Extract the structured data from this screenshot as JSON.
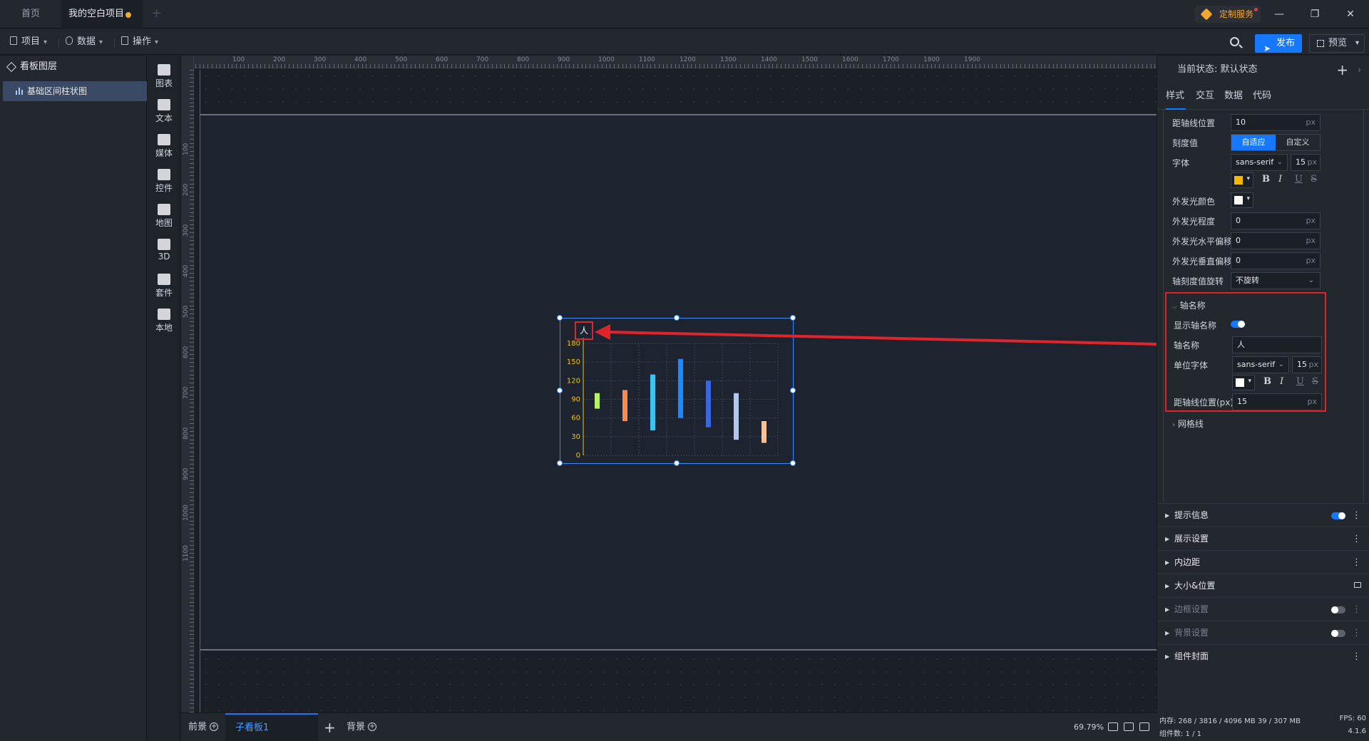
{
  "titlebar": {
    "tabs": [
      "首页",
      "我的空白项目"
    ],
    "custom_service": "定制服务"
  },
  "toolbar": {
    "menus": [
      "项目",
      "数据",
      "操作"
    ],
    "publish": "发布",
    "preview": "预览"
  },
  "layers": {
    "title": "看板图层",
    "items": [
      "基础区间柱状图"
    ]
  },
  "tools": [
    "图表",
    "文本",
    "媒体",
    "控件",
    "地图",
    "3D",
    "套件",
    "本地"
  ],
  "ruler": {
    "top": [
      "100",
      "200",
      "300",
      "400",
      "500",
      "600",
      "700",
      "800",
      "900",
      "1000",
      "1100",
      "1200",
      "1300",
      "1400",
      "1500",
      "1600",
      "1700",
      "1800",
      "1900"
    ],
    "left": [
      "100",
      "200",
      "300",
      "400",
      "500",
      "600",
      "700",
      "800",
      "900",
      "1000",
      "1100"
    ]
  },
  "chart_data": {
    "type": "bar",
    "subtype": "range-bar",
    "y_axis_name": "人",
    "yticks": [
      0,
      30,
      60,
      90,
      120,
      150,
      180
    ],
    "ylim": [
      0,
      180
    ],
    "grid": true,
    "axis_color": "#f0c020",
    "series": [
      {
        "range": [
          75,
          100
        ],
        "color": "#b8f06a"
      },
      {
        "range": [
          55,
          105
        ],
        "color": "#ff8a4c"
      },
      {
        "range": [
          40,
          130
        ],
        "color": "#3fc0f0"
      },
      {
        "range": [
          60,
          155
        ],
        "color": "#1e88ff"
      },
      {
        "range": [
          45,
          120
        ],
        "color": "#3a66e0"
      },
      {
        "range": [
          25,
          100
        ],
        "color": "#b0c8f0"
      },
      {
        "range": [
          20,
          55
        ],
        "color": "#f5c39a"
      }
    ]
  },
  "bottombar": {
    "front": "前景",
    "sub": "子看板1",
    "back": "背景",
    "zoom": "69.79%"
  },
  "props": {
    "state": "当前状态:  默认状态",
    "tabs": [
      "样式",
      "交互",
      "数据",
      "代码"
    ],
    "rows": {
      "axis_distance": {
        "label": "距轴线位置",
        "value": "10",
        "unit": "px"
      },
      "scale": {
        "label": "刻度值",
        "on": "自适应",
        "off": "自定义"
      },
      "font": {
        "label": "字体",
        "family": "sans-serif",
        "size": "15",
        "unit": "px",
        "color": "#f5b800"
      },
      "glow_color": {
        "label": "外发光颜色",
        "color": "#ffffff"
      },
      "glow_level": {
        "label": "外发光程度",
        "value": "0",
        "unit": "px"
      },
      "glow_h": {
        "label": "外发光水平偏移",
        "value": "0",
        "unit": "px"
      },
      "glow_v": {
        "label": "外发光垂直偏移",
        "value": "0",
        "unit": "px"
      },
      "tick_rotate": {
        "label": "轴刻度值旋转",
        "value": "不旋转"
      }
    },
    "axis_name_section": {
      "title": "轴名称",
      "show_label": "显示轴名称",
      "name_label": "轴名称",
      "name_value": "人",
      "unit_font_label": "单位字体",
      "unit_font_family": "sans-serif",
      "unit_font_size": "15",
      "unit_font_unit": "px",
      "unit_color": "#ffffff",
      "distance_label": "距轴线位置(px)",
      "distance_value": "15",
      "distance_unit": "px"
    },
    "gridline": "网格线",
    "sections": [
      "提示信息",
      "展示设置",
      "内边距",
      "大小&位置",
      "边框设置",
      "背景设置",
      "组件封面"
    ],
    "format": [
      "B",
      "I",
      "U",
      "S"
    ]
  },
  "status": {
    "memory": "内存:  268 / 3816 / 4096 MB  39 / 307 MB",
    "fps": "FPS:  60",
    "components": "组件数: 1 / 1",
    "version": "4.1.6"
  }
}
